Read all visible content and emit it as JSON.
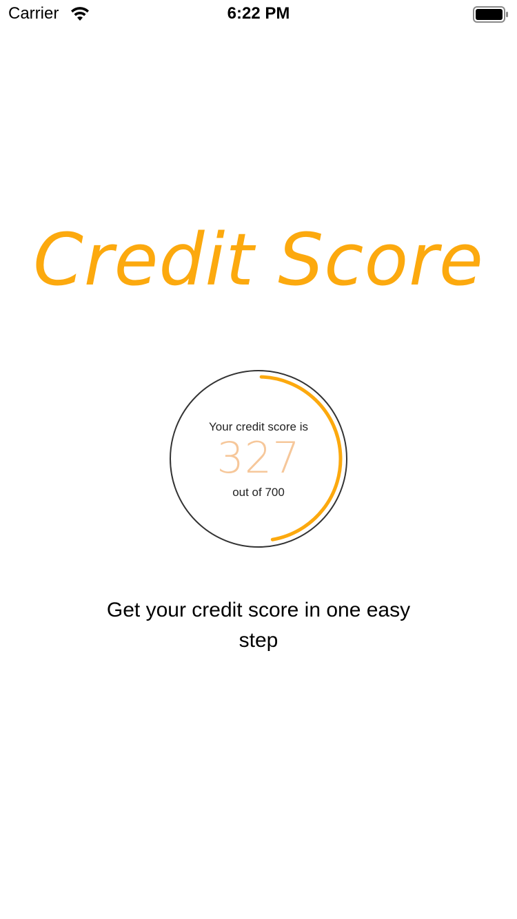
{
  "status_bar": {
    "carrier": "Carrier",
    "time": "6:22 PM"
  },
  "title": "Credit Score",
  "gauge": {
    "caption": "Your credit score is",
    "score": "327",
    "max_label": "out of 700",
    "score_value": 327,
    "score_max": 700,
    "arc_color": "#fca90e",
    "ring_color": "#333333"
  },
  "tagline": "Get your credit score in one easy step",
  "colors": {
    "accent": "#fca90e",
    "score_text": "#f6c79a"
  },
  "icons": [
    "wifi-icon",
    "battery-icon"
  ]
}
